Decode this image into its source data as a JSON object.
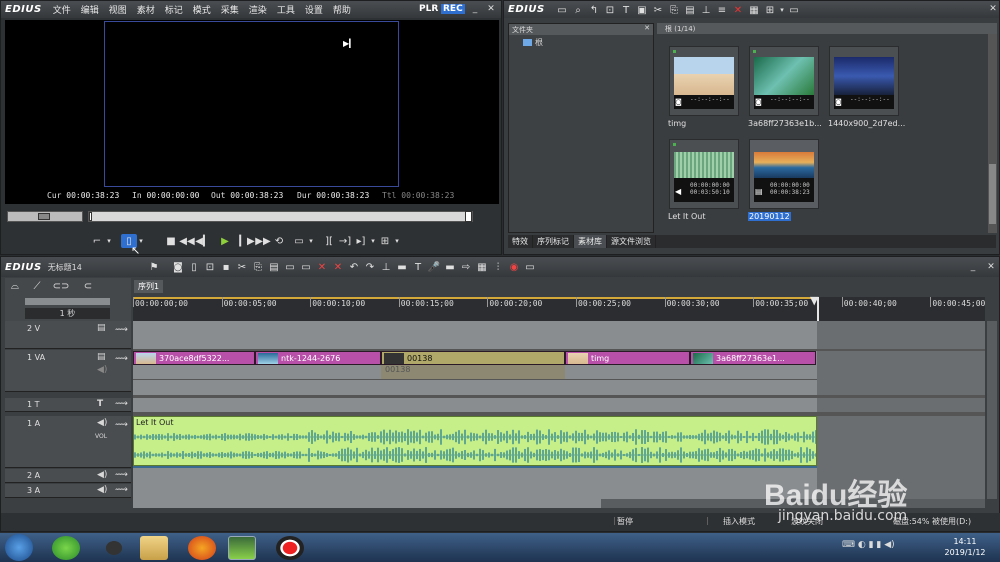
{
  "player": {
    "logo": "EDIUS",
    "menu": [
      "文件",
      "编辑",
      "视图",
      "素材",
      "标记",
      "模式",
      "采集",
      "渲染",
      "工具",
      "设置",
      "帮助"
    ],
    "plr": "PLR",
    "rec": "REC",
    "cur_label": "Cur",
    "cur": "00:00:38:23",
    "in_label": "In",
    "in": "00:00:00:00",
    "out_label": "Out",
    "out": "00:00:38:23",
    "dur_label": "Dur",
    "dur": "00:00:38:23",
    "ttl_label": "Ttl",
    "ttl": "00:00:38:23"
  },
  "bin": {
    "logo": "EDIUS",
    "folder_header": "文件夹",
    "root_folder": "根",
    "path": "根 (1/14)",
    "items": [
      {
        "name": "timg",
        "tc": "--:--:--:--"
      },
      {
        "name": "3a68ff27363e1b...",
        "tc": "--:--:--:--"
      },
      {
        "name": "1440x900_2d7ed...",
        "tc": "--:--:--:--"
      },
      {
        "name": "Let It Out",
        "tc1": "00:00:00:00",
        "tc2": "00:03:50:10"
      },
      {
        "name": "20190112",
        "tc1": "00:00:00:00",
        "tc2": "00:00:38:23"
      }
    ],
    "tabs": [
      "特效",
      "序列标记",
      "素材库",
      "源文件浏览"
    ]
  },
  "timeline": {
    "logo": "EDIUS",
    "project": "无标题14",
    "sequence_tab": "序列1",
    "scale": "1 秒",
    "ruler": [
      "00:00:00;00",
      "00:00:05;00",
      "00:00:10;00",
      "00:00:15;00",
      "00:00:20;00",
      "00:00:25;00",
      "00:00:30;00",
      "00:00:35;00",
      "00:00:40;00",
      "00:00:45;00"
    ],
    "tracks": {
      "v2": "2 V",
      "va1": "1 VA",
      "t1": "1 T",
      "a1": "1 A",
      "vol": "VOL",
      "a2": "2 A",
      "a3": "3 A"
    },
    "clips": [
      {
        "name": "370ace8df5322..."
      },
      {
        "name": "ntk-1244-2676"
      },
      {
        "name": "00138"
      },
      {
        "name": "timg"
      },
      {
        "name": "3a68ff27363e1..."
      }
    ],
    "clip_sub": "00138",
    "audio_clip": "Let It Out"
  },
  "status": {
    "pause": "暂停",
    "insert": "插入模式",
    "ripple": "波纹关闭",
    "disk": "磁盘:54% 被使用(D:)"
  },
  "taskbar": {
    "time": "14:11",
    "date": "2019/1/12"
  },
  "watermark": {
    "brand": "Baidu经验",
    "url": "jingyan.baidu.com"
  },
  "colors": {
    "rec": "#2f6fd0",
    "clip_video": "#b84fa8",
    "clip_va": "#b0a868",
    "clip_audio": "#c6ef8a",
    "playhead": "#e6e6e6"
  }
}
